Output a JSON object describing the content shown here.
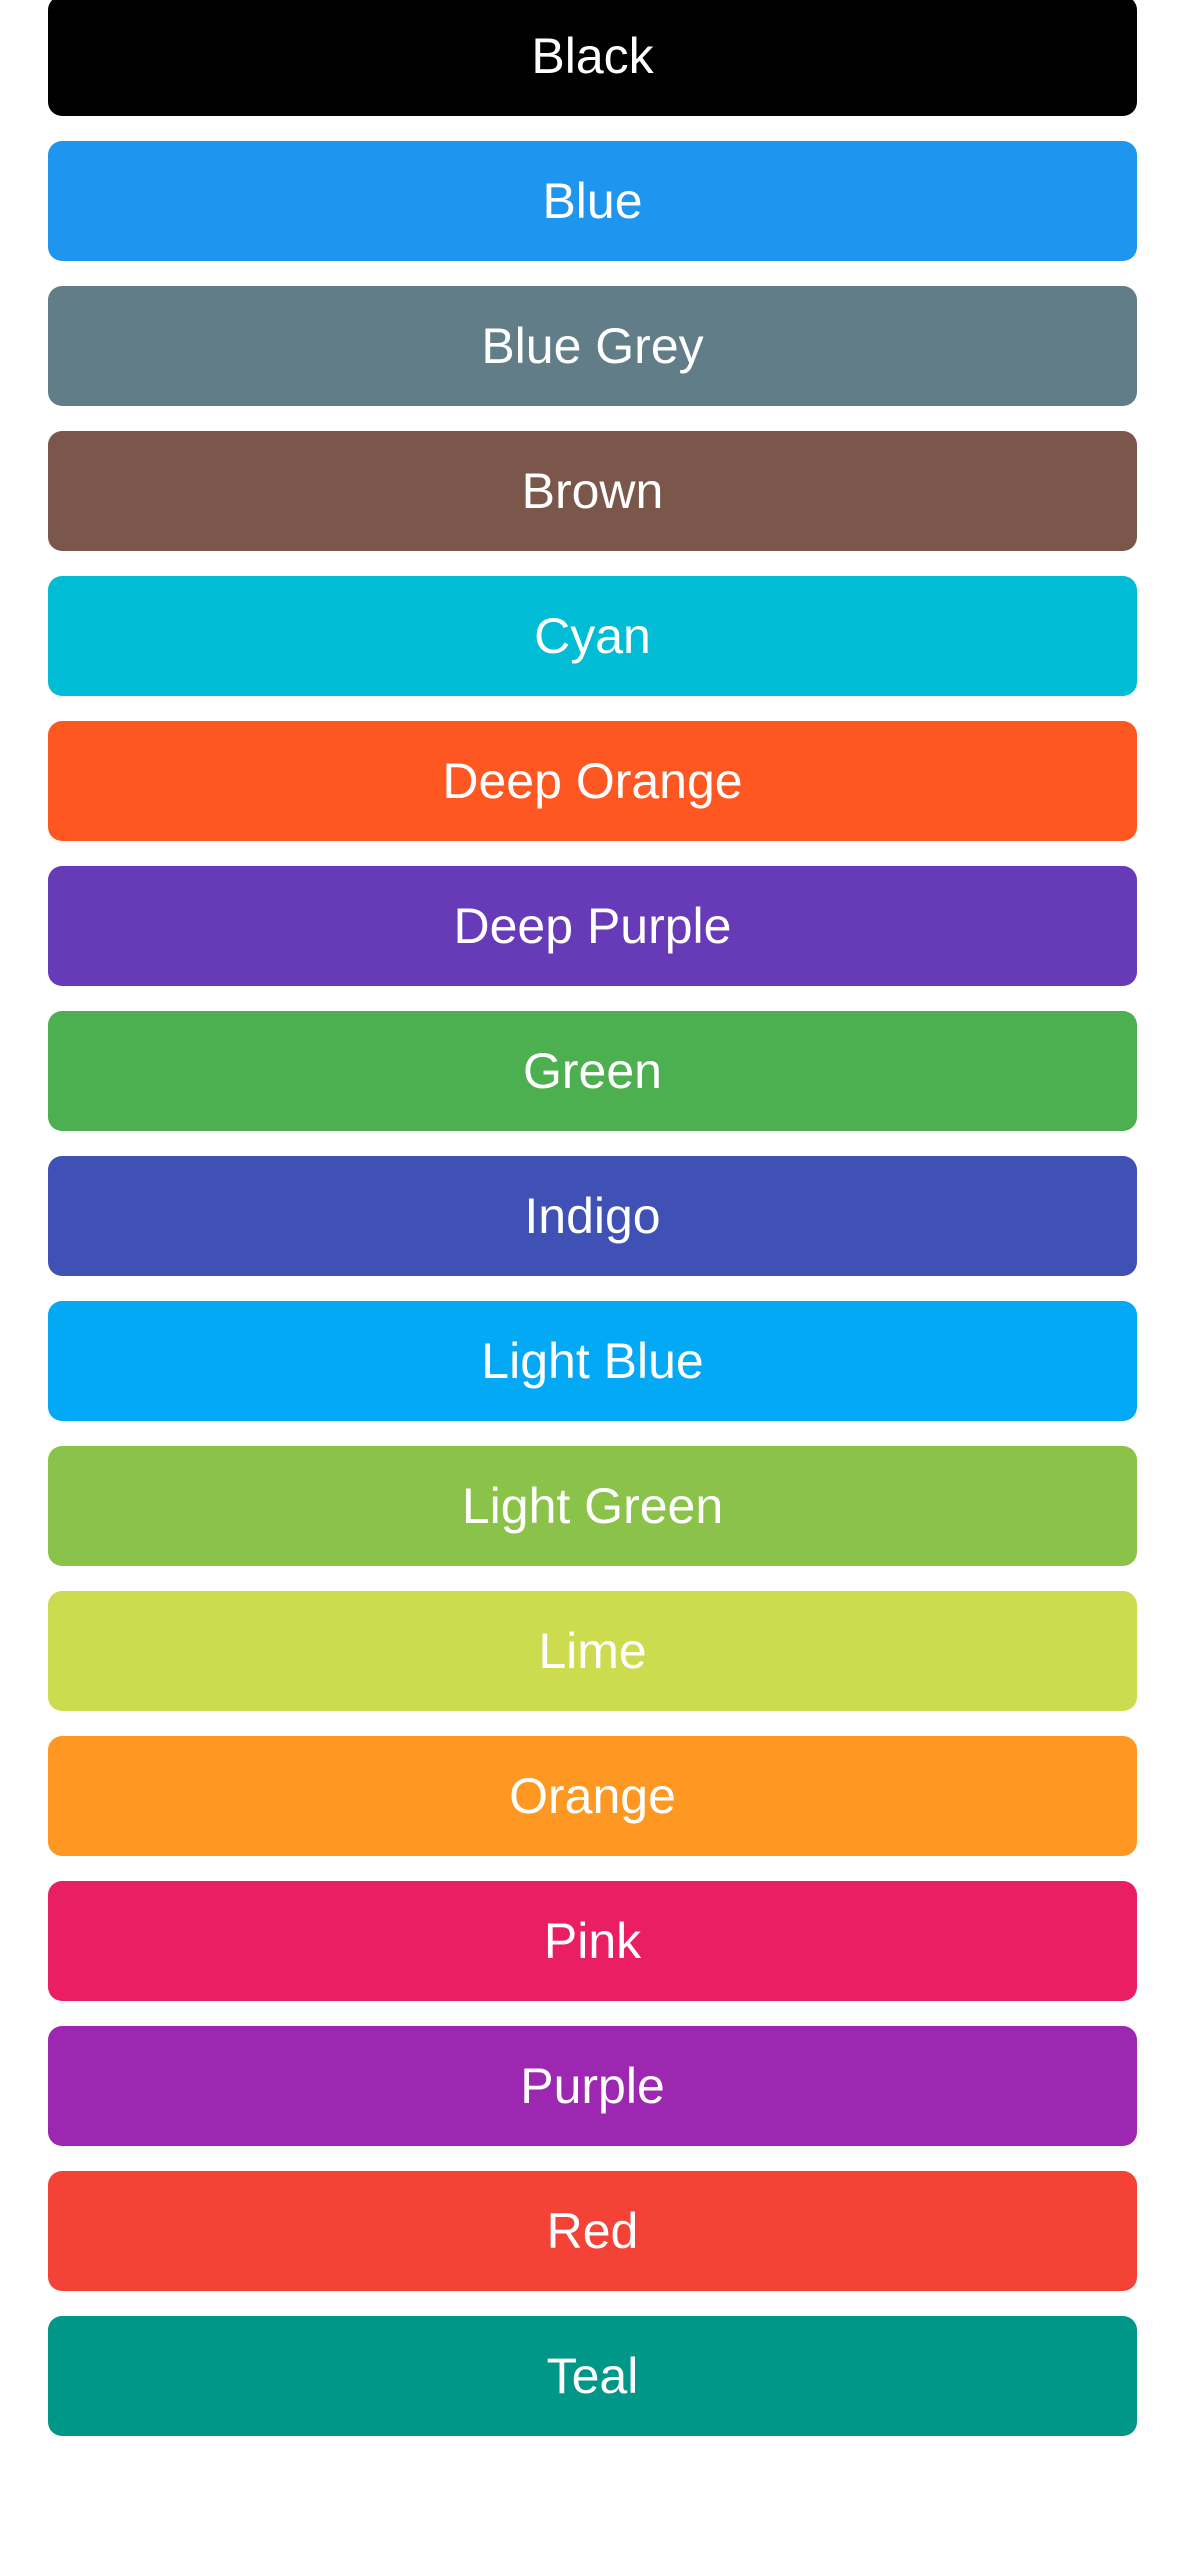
{
  "color_buttons": [
    {
      "label": "Black",
      "color": "#000000"
    },
    {
      "label": "Blue",
      "color": "#1E96F0"
    },
    {
      "label": "Blue Grey",
      "color": "#607D88"
    },
    {
      "label": "Brown",
      "color": "#7A574A"
    },
    {
      "label": "Cyan",
      "color": "#00BCD4"
    },
    {
      "label": "Deep Orange",
      "color": "#FF5722"
    },
    {
      "label": "Deep Purple",
      "color": "#673AB7"
    },
    {
      "label": "Green",
      "color": "#4CAF50"
    },
    {
      "label": "Indigo",
      "color": "#3F51B5"
    },
    {
      "label": "Light Blue",
      "color": "#03A9F4"
    },
    {
      "label": "Light Green",
      "color": "#8BC34A"
    },
    {
      "label": "Lime",
      "color": "#CDDC4E"
    },
    {
      "label": "Orange",
      "color": "#FF9822"
    },
    {
      "label": "Pink",
      "color": "#E91E63"
    },
    {
      "label": "Purple",
      "color": "#9C27B0"
    },
    {
      "label": "Red",
      "color": "#F44336"
    },
    {
      "label": "Teal",
      "color": "#009688"
    }
  ]
}
